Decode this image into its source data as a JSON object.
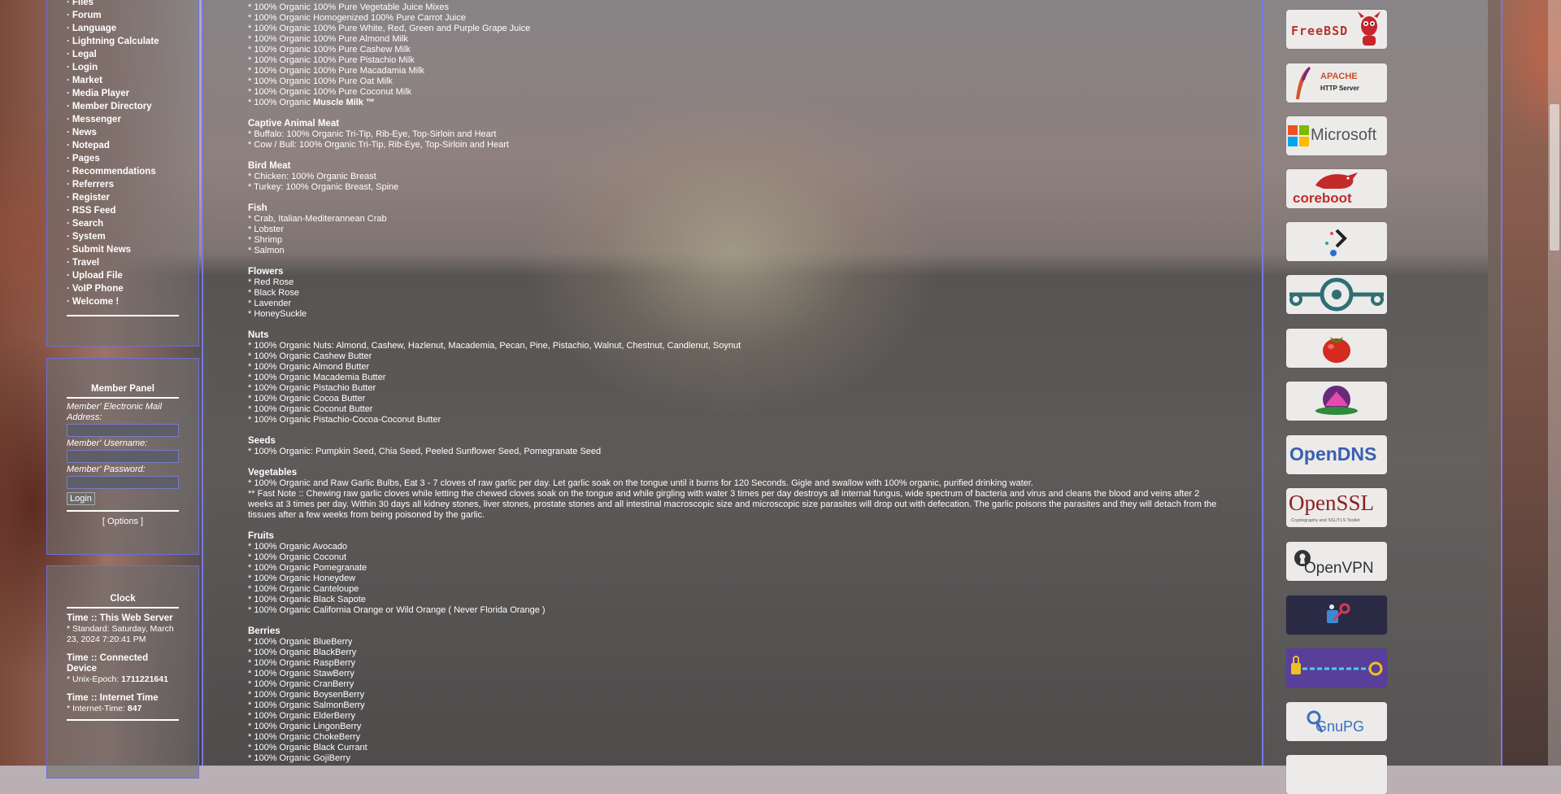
{
  "menu": {
    "items": [
      "Files",
      "Forum",
      "Language",
      "Lightning Calculate",
      "Legal",
      "Login",
      "Market",
      "Media Player",
      "Member Directory",
      "Messenger",
      "News",
      "Notepad",
      "Pages",
      "Recommendations",
      "Referrers",
      "Register",
      "RSS Feed",
      "Search",
      "System",
      "Submit News",
      "Travel",
      "Upload File",
      "VoIP Phone",
      "Welcome !"
    ]
  },
  "member_panel": {
    "title": "Member Panel",
    "email_label": "Member' Electronic Mail Address:",
    "username_label": "Member' Username:",
    "password_label": "Member' Password:",
    "login_button": "Login",
    "options_link": "[ Options ]"
  },
  "clock": {
    "title": "Clock",
    "server_head": "Time :: This Web Server",
    "server_value": "* Standard: Saturday, March 23, 2024 7:20:41 PM",
    "device_head": "Time :: Connected Device",
    "device_prefix": "* Unix-Epoch: ",
    "device_value": "1711221641",
    "internet_head": "Time :: Internet Time",
    "internet_prefix": "* Internet-Time: ",
    "internet_value": "847"
  },
  "content": {
    "top_lines": [
      "* 100% Organic 100% Pure Vegetable Juice Mixes",
      "* 100% Organic Homogenized 100% Pure Carrot Juice",
      "* 100% Organic 100% Pure White, Red, Green and Purple Grape Juice",
      "* 100% Organic 100% Pure Almond Milk",
      "* 100% Organic 100% Pure Cashew Milk",
      "* 100% Organic 100% Pure Pistachio Milk",
      "* 100% Organic 100% Pure Macadamia Milk",
      "* 100% Organic 100% Pure Oat Milk",
      "* 100% Organic 100% Pure Coconut Milk"
    ],
    "muscle_prefix": "* 100% Organic ",
    "muscle_bold": "Muscle Milk ™",
    "sections": [
      {
        "head": "Captive Animal Meat",
        "lines": [
          "* Buffalo: 100% Organic Tri-Tip, Rib-Eye, Top-Sirloin and Heart",
          "* Cow / Bull: 100% Organic Tri-Tip, Rib-Eye, Top-Sirloin and Heart"
        ]
      },
      {
        "head": "Bird Meat",
        "lines": [
          "* Chicken: 100% Organic Breast",
          "* Turkey: 100% Organic Breast, Spine"
        ]
      },
      {
        "head": "Fish",
        "lines": [
          "* Crab, Italian-Mediterannean Crab",
          "* Lobster",
          "* Shrimp",
          "* Salmon"
        ]
      },
      {
        "head": "Flowers",
        "lines": [
          "* Red Rose",
          "* Black Rose",
          "* Lavender",
          "* HoneySuckle"
        ]
      },
      {
        "head": "Nuts",
        "lines": [
          "* 100% Organic Nuts: Almond, Cashew, Hazlenut, Macademia, Pecan, Pine, Pistachio, Walnut, Chestnut, Candlenut, Soynut",
          "* 100% Organic Cashew Butter",
          "* 100% Organic Almond Butter",
          "* 100% Organic Macademia Butter",
          "* 100% Organic Pistachio Butter",
          "* 100% Organic Cocoa Butter",
          "* 100% Organic Coconut Butter",
          "* 100% Organic Pistachio-Cocoa-Coconut Butter"
        ]
      },
      {
        "head": "Seeds",
        "lines": [
          "* 100% Organic: Pumpkin Seed, Chia Seed, Peeled Sunflower Seed, Pomegranate Seed"
        ]
      },
      {
        "head": "Vegetables",
        "lines": [
          "* 100% Organic and Raw Garlic Bulbs, Eat 3 - 7 cloves of raw garlic per day. Let garlic soak on the tongue until it burns for 120 Seconds. Gigle and swallow with 100% organic, purified drinking water.",
          "** Fast Note :: Chewing raw garlic cloves while letting the chewed cloves soak on the tongue and while girgling with water 3 times per day destroys all internal fungus, wide spectrum of bacteria and virus and cleans the blood and veins after 2 weeks at 3 times per day. Within 30 days all kidney stones, liver stones, prostate stones and all intestinal macroscopic size and microscopic size parasites will drop out with defecation. The garlic poisons the parasites and they will detach from the tissues after a few weeks from being poisoned by the garlic."
        ]
      },
      {
        "head": "Fruits",
        "lines": [
          "* 100% Organic Avocado",
          "* 100% Organic Coconut",
          "* 100% Organic Pomegranate",
          "* 100% Organic Honeydew",
          "* 100% Organic Canteloupe",
          "* 100% Organic Black Sapote",
          "* 100% Organic California Orange or Wild Orange ( Never Florida Orange )"
        ]
      },
      {
        "head": "Berries",
        "lines": [
          "* 100% Organic BlueBerry",
          "* 100% Organic BlackBerry",
          "* 100% Organic RaspBerry",
          "* 100% Organic StawBerry",
          "* 100% Organic CranBerry",
          "* 100% Organic BoysenBerry",
          "* 100% Organic SalmonBerry",
          "* 100% Organic ElderBerry",
          "* 100% Organic LingonBerry",
          "* 100% Organic ChokeBerry",
          "* 100% Organic Black Currant",
          "* 100% Organic GojiBerry"
        ]
      }
    ]
  },
  "logos": {
    "freebsd": "FreeBSD",
    "apache_line1": "APACHE",
    "apache_line2": "HTTP Server",
    "microsoft": "Microsoft",
    "coreboot": "coreboot",
    "opendns": "OpenDNS",
    "openssl": "OpenSSL",
    "openssl_sub": "Cryptography and SSL/TLS Toolkit",
    "openvpn": "OpenVPN",
    "gnupg": "GnuPG"
  },
  "colors": {
    "panel_border": "#7878e0",
    "freebsd_red": "#b5332e",
    "apache_orange": "#c8502a",
    "opendns_blue": "#3a5fb0",
    "openssl_red": "#8b1e1e",
    "teal": "#2f6f73"
  }
}
